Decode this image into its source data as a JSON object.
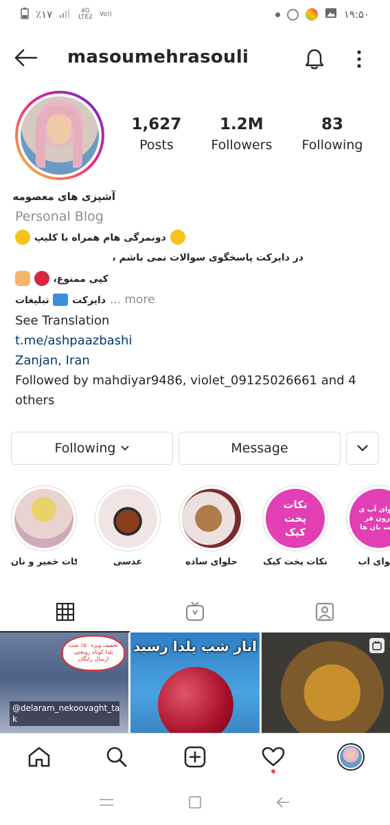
{
  "status_bar": {
    "battery_percent": "٪۱۷",
    "network_top": "4G",
    "network_bottom": "LTE2",
    "volte_top": "Vo))",
    "time": "۱۹:۵۰"
  },
  "header": {
    "username": "masoumehrasouli",
    "back_icon": "arrow-left-icon",
    "bell_icon": "bell-icon",
    "more_icon": "vertical-dots-icon"
  },
  "stats": {
    "posts": {
      "value": "1,627",
      "label": "Posts"
    },
    "followers": {
      "value": "1.2M",
      "label": "Followers"
    },
    "following": {
      "value": "83",
      "label": "Following"
    }
  },
  "bio": {
    "name": "آشپزی های معصومه",
    "category": "Personal Blog",
    "line1": "دونمرگی هام همراه با کلیپ",
    "line2": "در دایرکت پاسخگوی سوالات نمی باشم ،",
    "line3": "کپی ممنوع،",
    "line4": "تبلیغات",
    "line4_tail": "دایرکت",
    "more": "... more",
    "see_translation": "See Translation",
    "link": "t.me/ashpaazbashi",
    "location": "Zanjan, Iran",
    "followed_by_1": "Followed by mahdiyar9486, violet_09125026661 and 4",
    "followed_by_2": "others"
  },
  "buttons": {
    "following": "Following",
    "message": "Message"
  },
  "highlights": [
    {
      "label": "نکات خمیر و نان",
      "text": ""
    },
    {
      "label": "عدسی",
      "text": ""
    },
    {
      "label": "حلوای ساده",
      "text": ""
    },
    {
      "label": "نکات پخت کیک",
      "text": "نکات پخت کیک"
    },
    {
      "label": "حلوای آب",
      "text": "حلوای آب ی درون فر پخت نان ها"
    }
  ],
  "grid": {
    "post1_caption": "@delaram_nekoovaght_ta k",
    "post1_bubble": "تخفیف ویژه ۵۰٪ شب یلدا کوتاه روتختی ارسال رایگان",
    "post2_title": "انار شب یلدا رسید"
  },
  "colors": {
    "text": "#262626",
    "secondary": "#8e8e8e",
    "link": "#00376b",
    "border": "#dbdbdb",
    "notification_dot": "#ed4956",
    "highlight_pink": "#e23fb4"
  }
}
